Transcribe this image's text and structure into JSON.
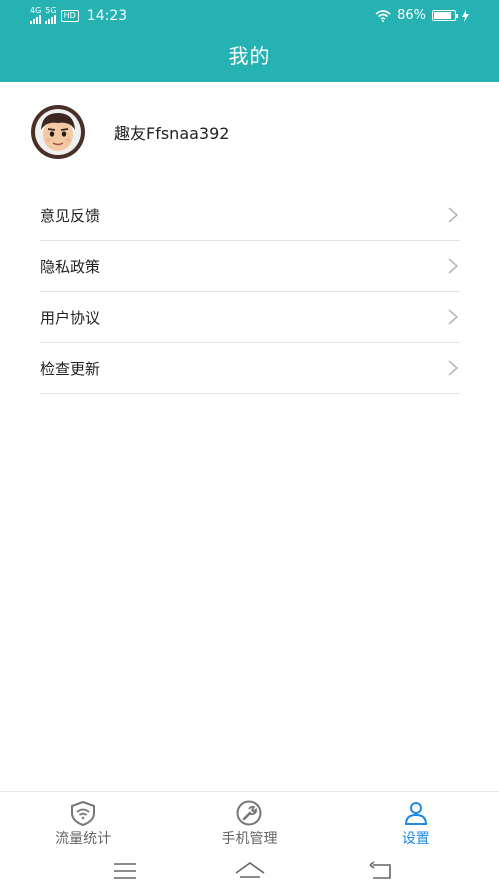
{
  "status": {
    "network1": "4G",
    "network2": "5G",
    "hd": "HD",
    "time": "14:23",
    "battery": "86%",
    "battery_level": 0.86
  },
  "header": {
    "title": "我的"
  },
  "profile": {
    "username": "趣友Ffsnaa392"
  },
  "menu": {
    "items": [
      {
        "label": "意见反馈"
      },
      {
        "label": "隐私政策"
      },
      {
        "label": "用户协议"
      },
      {
        "label": "检查更新"
      }
    ]
  },
  "tabs": [
    {
      "label": "流量统计",
      "icon": "shield-wifi-icon",
      "active": false
    },
    {
      "label": "手机管理",
      "icon": "wrench-icon",
      "active": false
    },
    {
      "label": "设置",
      "icon": "person-icon",
      "active": true
    }
  ],
  "colors": {
    "header": "#26b1b3",
    "active_tab": "#1e88e5",
    "inactive_tab": "#666666"
  },
  "navbar": {
    "icons": [
      "menu-icon",
      "home-icon",
      "back-icon"
    ]
  }
}
